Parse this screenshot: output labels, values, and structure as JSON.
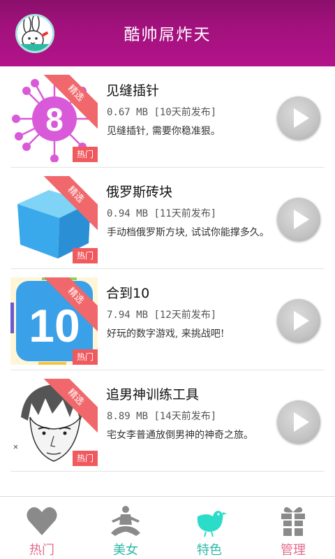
{
  "header": {
    "title": "酷帅屌炸天",
    "avatar_icon": "bunny-avatar-icon"
  },
  "apps": [
    {
      "name": "见缝插针",
      "size": "0.67 MB",
      "published": "[10天前发布]",
      "description": "见缝插针, 需要你稳准狠。",
      "ribbon": "精选",
      "tag": "热门",
      "icon": "pin-game-icon"
    },
    {
      "name": "俄罗斯砖块",
      "size": "0.94 MB",
      "published": "[11天前发布]",
      "description": "手动档俄罗斯方块, 试试你能撑多久。",
      "ribbon": "精选",
      "tag": "热门",
      "icon": "blue-cube-icon"
    },
    {
      "name": "合到10",
      "size": "7.94 MB",
      "published": "[12天前发布]",
      "description": "好玩的数字游戏, 来挑战吧!",
      "ribbon": "精选",
      "tag": "热门",
      "icon": "number-10-icon"
    },
    {
      "name": "追男神训练工具",
      "size": "8.89 MB",
      "published": "[14天前发布]",
      "description": "宅女李普通放倒男神的神奇之旅。",
      "ribbon": "精选",
      "tag": "热门",
      "icon": "sketch-man-icon"
    }
  ],
  "bottom_nav": [
    {
      "label": "热门",
      "icon": "heart-icon",
      "color": "#e46a8c"
    },
    {
      "label": "美女",
      "icon": "yoga-figure-icon",
      "color": "#2bb9a6"
    },
    {
      "label": "特色",
      "icon": "bird-icon",
      "color": "#2bb9a6",
      "active": true
    },
    {
      "label": "管理",
      "icon": "gift-icon",
      "color": "#e46a8c"
    }
  ],
  "colors": {
    "header": "#a0117c",
    "ribbon": "#f0686b",
    "tag": "#f05a5e",
    "accent_teal": "#2bb9a6",
    "accent_pink": "#e46a8c"
  }
}
